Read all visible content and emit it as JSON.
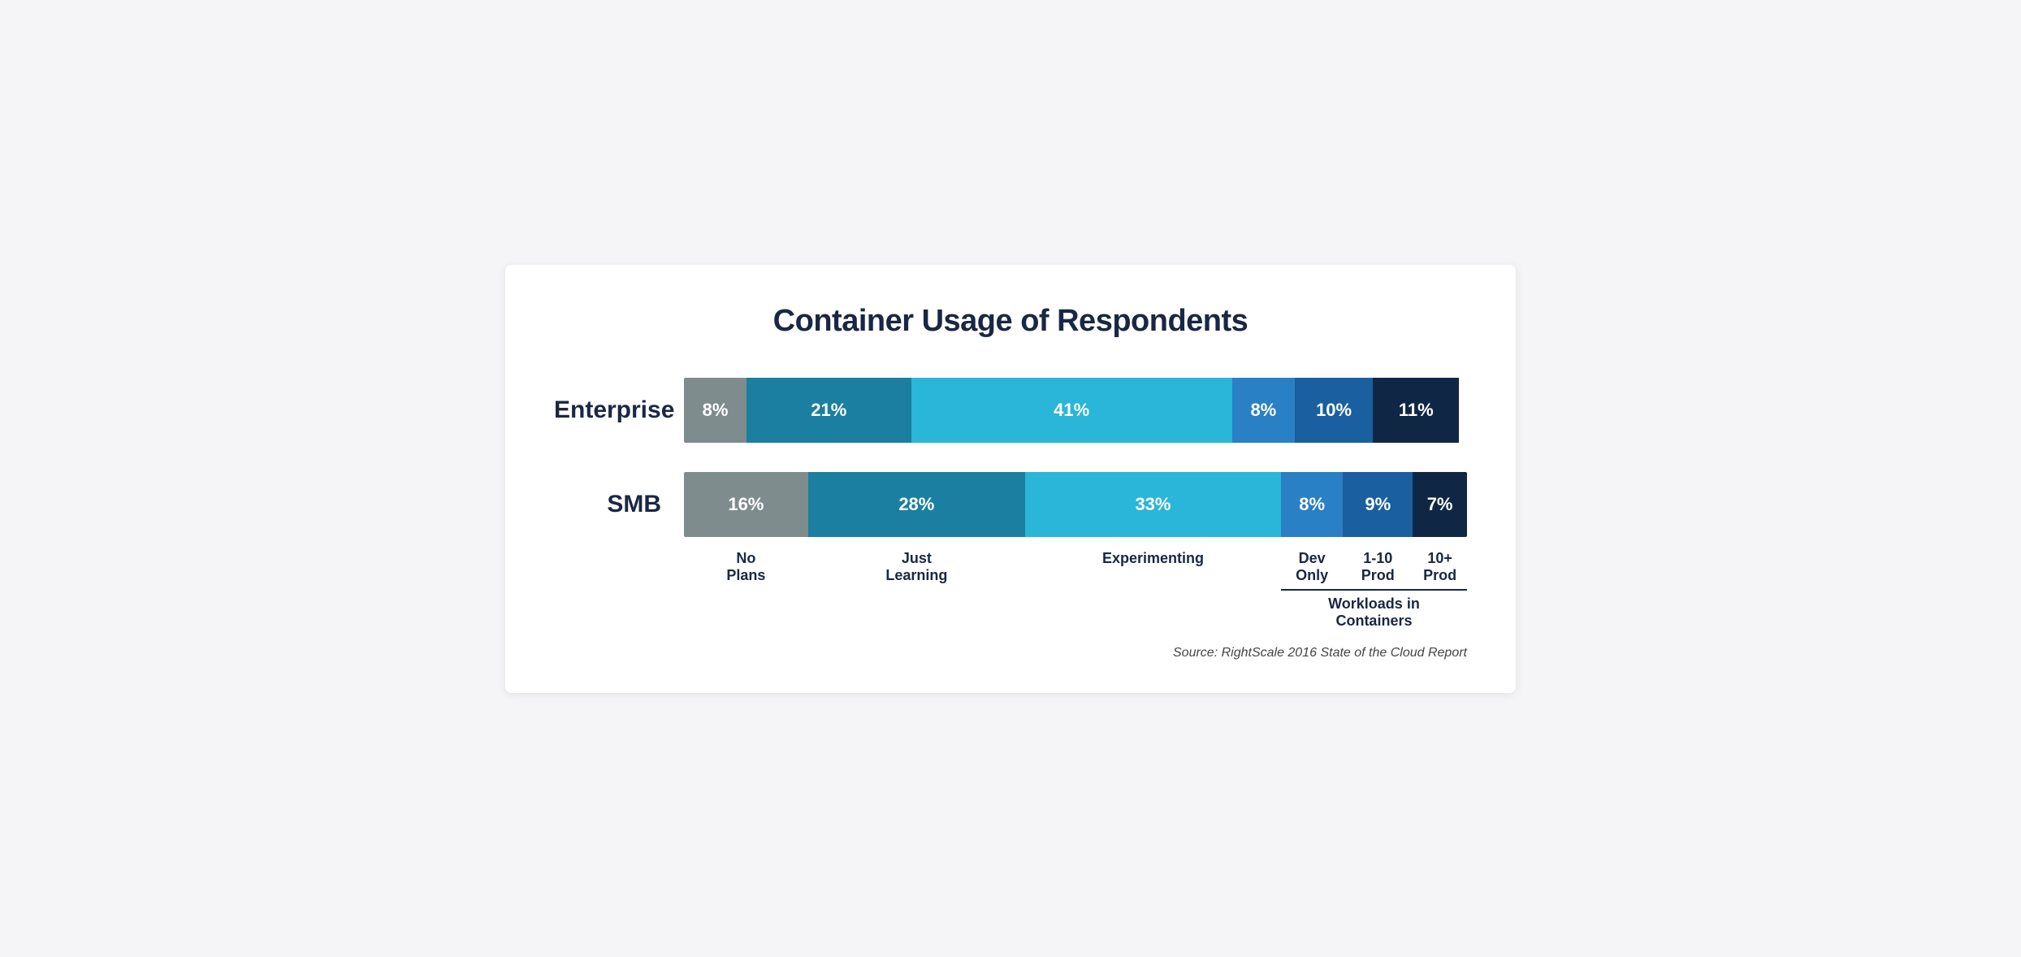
{
  "chart": {
    "title": "Container Usage of Respondents",
    "source": "Source: RightScale 2016 State of the Cloud Report",
    "enterprise": {
      "label": "Enterprise",
      "segments": [
        {
          "id": "no-plans",
          "pct": 8,
          "label": "8%",
          "color": "color-gray"
        },
        {
          "id": "just-learning",
          "pct": 21,
          "label": "21%",
          "color": "color-teal"
        },
        {
          "id": "experimenting",
          "pct": 41,
          "label": "41%",
          "color": "color-cyan"
        },
        {
          "id": "dev-only",
          "pct": 8,
          "label": "8%",
          "color": "color-blue"
        },
        {
          "id": "prod-1-10",
          "pct": 10,
          "label": "10%",
          "color": "color-dblue"
        },
        {
          "id": "prod-10plus",
          "pct": 11,
          "label": "11%",
          "color": "color-darkest"
        }
      ]
    },
    "smb": {
      "label": "SMB",
      "segments": [
        {
          "id": "no-plans",
          "pct": 16,
          "label": "16%",
          "color": "color-gray"
        },
        {
          "id": "just-learning",
          "pct": 28,
          "label": "28%",
          "color": "color-teal"
        },
        {
          "id": "experimenting",
          "pct": 33,
          "label": "33%",
          "color": "color-cyan"
        },
        {
          "id": "dev-only",
          "pct": 8,
          "label": "8%",
          "color": "color-blue"
        },
        {
          "id": "prod-1-10",
          "pct": 9,
          "label": "9%",
          "color": "color-dblue"
        },
        {
          "id": "prod-10plus",
          "pct": 7,
          "label": "7%",
          "color": "color-darkest"
        }
      ]
    },
    "axis_labels": {
      "no_plans": "No\nPlans",
      "just_learning": "Just\nLearning",
      "experimenting": "Experimenting",
      "dev_only": "Dev\nOnly",
      "prod_1_10": "1-10\nProd",
      "prod_10plus": "10+\nProd",
      "workloads_title": "Workloads in\nContainers"
    }
  }
}
